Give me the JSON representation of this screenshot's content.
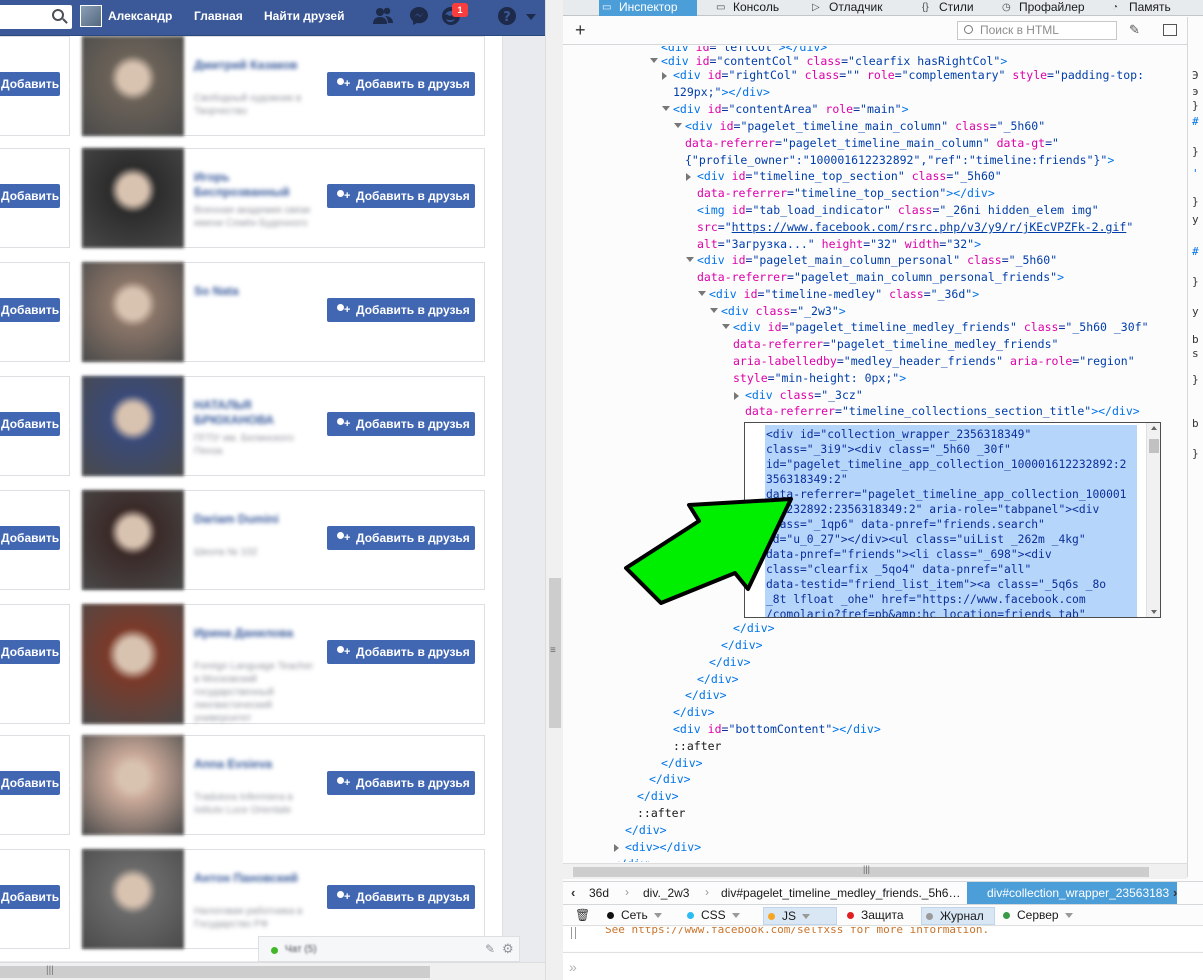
{
  "facebook": {
    "topbar": {
      "user_name": "Александр",
      "home_label": "Главная",
      "find_friends_label": "Найти друзей",
      "notification_badge": "1"
    },
    "add_friend_label": "Добавить в друзья",
    "chat": {
      "label": "Чат (5)"
    },
    "people": [
      {
        "name": "Дмитрий Казаков",
        "sub": "Свободный художник в Творчество"
      },
      {
        "name": "Игорь Беспрозванный",
        "sub": "Военная академия связи имени Семён Буденного"
      },
      {
        "name": "So Nata",
        "sub": ""
      },
      {
        "name": "НАТАЛЬЯ БРЮХАНОВА",
        "sub": "ПГПУ им. Белинского Пенза"
      },
      {
        "name": "Dariam Dumini",
        "sub": "Школа № 102"
      },
      {
        "name": "Ирина Данилова",
        "sub": "Foreign Language Teacher в Московский государственный лингвистический университет"
      },
      {
        "name": "Anna Evsieva",
        "sub": "Tradutora Infermiera в Istituto Luce Orientale"
      },
      {
        "name": "Антон Пановский",
        "sub": "Налоговая работника в Государство РФ"
      }
    ],
    "photo_colors": [
      "#6b6258",
      "#2c2c2c",
      "#8a7568",
      "#3a4a78",
      "#3a2a28",
      "#7a3a2a",
      "#c8a898",
      "#6a6a6a"
    ]
  },
  "devtools": {
    "tabs": [
      {
        "label": "Инспектор",
        "icon": "inspector-icon",
        "selected": true
      },
      {
        "label": "Консоль",
        "icon": "console-icon",
        "selected": false
      },
      {
        "label": "Отладчик",
        "icon": "debugger-icon",
        "selected": false
      },
      {
        "label": "Стили",
        "icon": "styles-icon",
        "selected": false
      },
      {
        "label": "Профайлер",
        "icon": "profiler-icon",
        "selected": false
      },
      {
        "label": "Память",
        "icon": "memory-icon",
        "selected": false
      }
    ],
    "search_placeholder": "Поиск в HTML",
    "edit_box_lines": [
      "<div id=\"collection_wrapper_2356318349\"",
      "class=\"_3i9\"><div class=\"_5h60 _30f\"",
      "id=\"pagelet_timeline_app_collection_100001612232892:2",
      "356318349:2\"",
      "data-referrer=\"pagelet_timeline_app_collection_100001",
      "612232892:2356318349:2\" aria-role=\"tabpanel\"><div",
      "class=\"_1qp6\" data-pnref=\"friends.search\"",
      "id=\"u_0_27\"></div><ul class=\"uiList _262m _4kg\"",
      "data-pnref=\"friends\"><li class=\"_698\"><div",
      "class=\"clearfix _5qo4\" data-pnref=\"all\"",
      "data-testid=\"friend_list_item\"><a class=\"_5q6s _8o",
      "_8t lfloat _ohe\" href=\"https://www.facebook.com",
      "/comolario?fref=pb&amp;hc_location=friends_tab\""
    ],
    "breadcrumbs": [
      "36d",
      "div._2w3",
      "div#pagelet_timeline_medley_friends._5h6…"
    ],
    "breadcrumb_selected": "div#collection_wrapper_23563183",
    "console_filters": [
      {
        "label": "Сеть",
        "color": "#111111",
        "on": false
      },
      {
        "label": "CSS",
        "color": "#2cbbf2",
        "on": false
      },
      {
        "label": "JS",
        "color": "#f5a623",
        "on": true
      },
      {
        "label": "Защита",
        "color": "#e02020",
        "on": false
      },
      {
        "label": "Журнал",
        "color": "#9a9a9a",
        "on": true
      },
      {
        "label": "Сервер",
        "color": "#3a9a4a",
        "on": false
      }
    ],
    "console_message": "See https://www.facebook.com/selfxss for more information.",
    "console_prompt": "»",
    "right_panel_glyphs": [
      "Э",
      "э",
      "}",
      "#",
      "}",
      "'",
      "}",
      "у",
      "#",
      "}",
      "у",
      "b",
      "s",
      "}",
      "b",
      "}"
    ]
  },
  "arrow_color": "#00ee00"
}
